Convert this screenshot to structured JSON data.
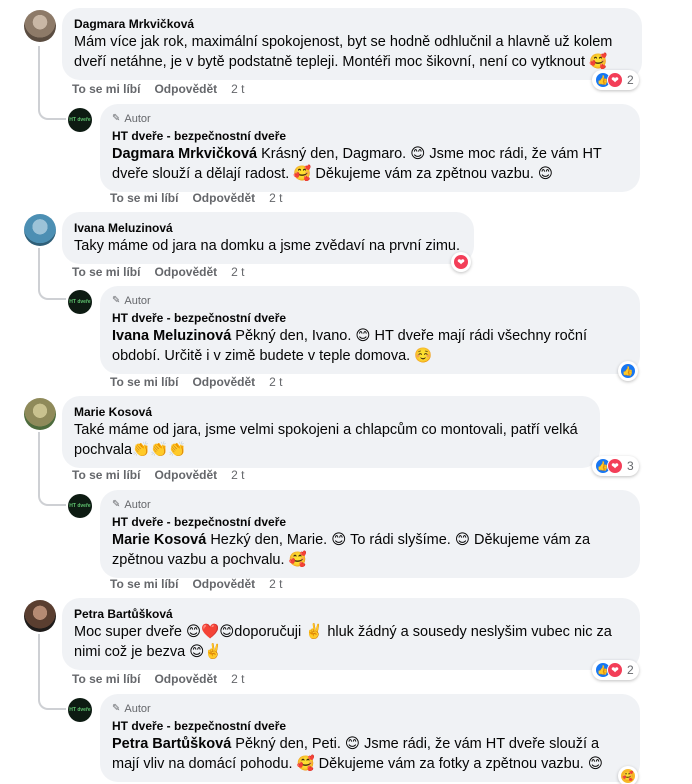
{
  "labels": {
    "like": "To se mi líbí",
    "reply": "Odpovědět",
    "autor": "Autor"
  },
  "colors": {
    "like": "#1877f2",
    "love": "#f33e58",
    "bubble": "#f0f2f5",
    "meta": "#65676b"
  },
  "page": {
    "name": "HT dveře - bezpečnostní dveře",
    "logo_text": "HT dveře"
  },
  "comments": [
    {
      "author": "Dagmara Mrkvičková",
      "text": "Mám více jak rok, maximální spokojenost, byt se hodně odhlučnil a hlavně už kolem dveří netáhne, je v bytě podstatně tepleji. Montéři moc šikovní, není co vytknout 🥰",
      "time": "2 t",
      "reaction_count": "2",
      "reply": {
        "mention": "Dagmara Mrkvičková",
        "text": " Krásný den, Dagmaro. 😊 Jsme moc rádi, že vám HT dveře slouží a dělají radost. 🥰 Děkujeme vám za zpětnou vazbu. 😊",
        "time": "2 t"
      }
    },
    {
      "author": "Ivana Meluzinová",
      "text": "Taky máme od jara na domku a jsme zvědaví na první zimu.",
      "time": "2 t",
      "reaction_count": "",
      "reply": {
        "mention": "Ivana Meluzinová",
        "text": " Pěkný den, Ivano. 😊 HT dveře mají rádi všechny roční období. Určitě i v zimě budete v teple domova. ☺️",
        "time": "2 t"
      }
    },
    {
      "author": "Marie Kosová",
      "text": "Také máme od jara, jsme velmi spokojeni a chlapcům co montovali, patří velká pochvala👏👏👏",
      "time": "2 t",
      "reaction_count": "3",
      "reply": {
        "mention": "Marie Kosová",
        "text": " Hezký den, Marie. 😊 To rádi slyšíme. 😊 Děkujeme vám za zpětnou vazbu a pochvalu. 🥰",
        "time": "2 t"
      }
    },
    {
      "author": "Petra Bartůšková",
      "text": "Moc super dveře 😊❤️😊doporučuji ✌️ hluk žádný a sousedy neslyšim vubec nic za nimi což je bezva 😊✌️",
      "time": "2 t",
      "reaction_count": "2",
      "reply": {
        "mention": "Petra Bartůšková",
        "text": " Pěkný den, Peti. 😊 Jsme rádi, že vám HT dveře slouží a mají vliv na domácí pohodu. 🥰 Děkujeme vám za fotky a zpětnou vazbu. 😊"
      }
    }
  ]
}
